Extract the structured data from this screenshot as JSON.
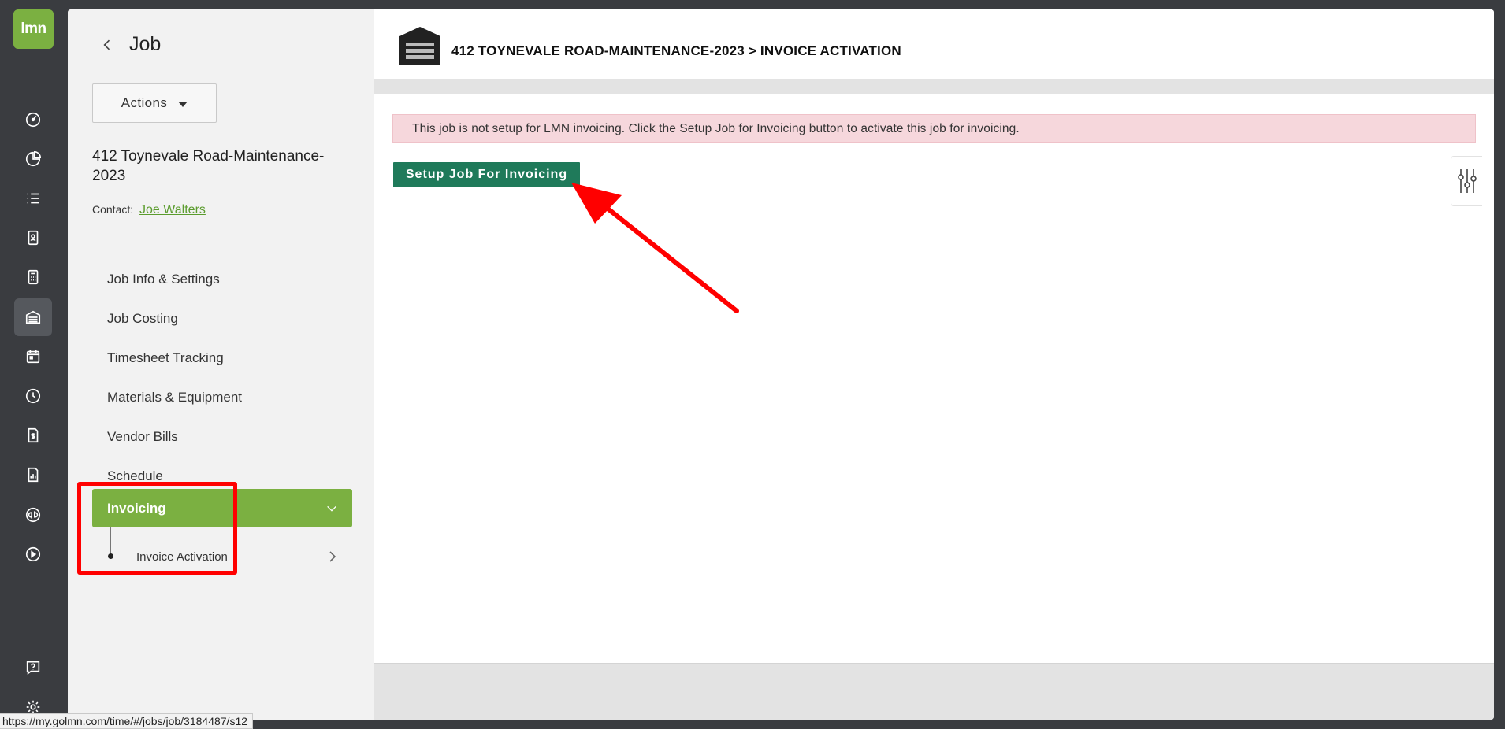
{
  "rail": {
    "logo_text": "lmn",
    "icons": [
      "dashboard-icon",
      "chart-pie-icon",
      "list-icon",
      "contacts-icon",
      "calculator-icon",
      "garage-icon",
      "calendar-icon",
      "clock-icon",
      "invoice-icon",
      "report-icon",
      "quickbooks-icon",
      "play-icon",
      "help-icon",
      "settings-icon"
    ],
    "active": "garage-icon"
  },
  "panel": {
    "back_title": "Job",
    "actions_label": "Actions",
    "job_name": "412 Toynevale Road-Maintenance-2023",
    "contact_label": "Contact:",
    "contact_name": "Joe Walters",
    "nav": [
      "Job Info & Settings",
      "Job Costing",
      "Timesheet Tracking",
      "Materials & Equipment",
      "Vendor Bills",
      "Schedule"
    ],
    "active_nav": "Invoicing",
    "sub_item": "Invoice Activation"
  },
  "content": {
    "breadcrumb": "412 TOYNEVALE ROAD-MAINTENANCE-2023 > INVOICE ACTIVATION",
    "alert": "This job is not setup for LMN invoicing. Click the Setup Job for Invoicing button to activate this job for invoicing.",
    "setup_button": "Setup Job For Invoicing"
  },
  "status_url": "https://my.golmn.com/time/#/jobs/job/3184487/s12",
  "colors": {
    "accent_green": "#7bb041",
    "button_teal": "#1f7a5a",
    "alert_bg": "#f6d7dc",
    "annotation_red": "#ff0000"
  }
}
